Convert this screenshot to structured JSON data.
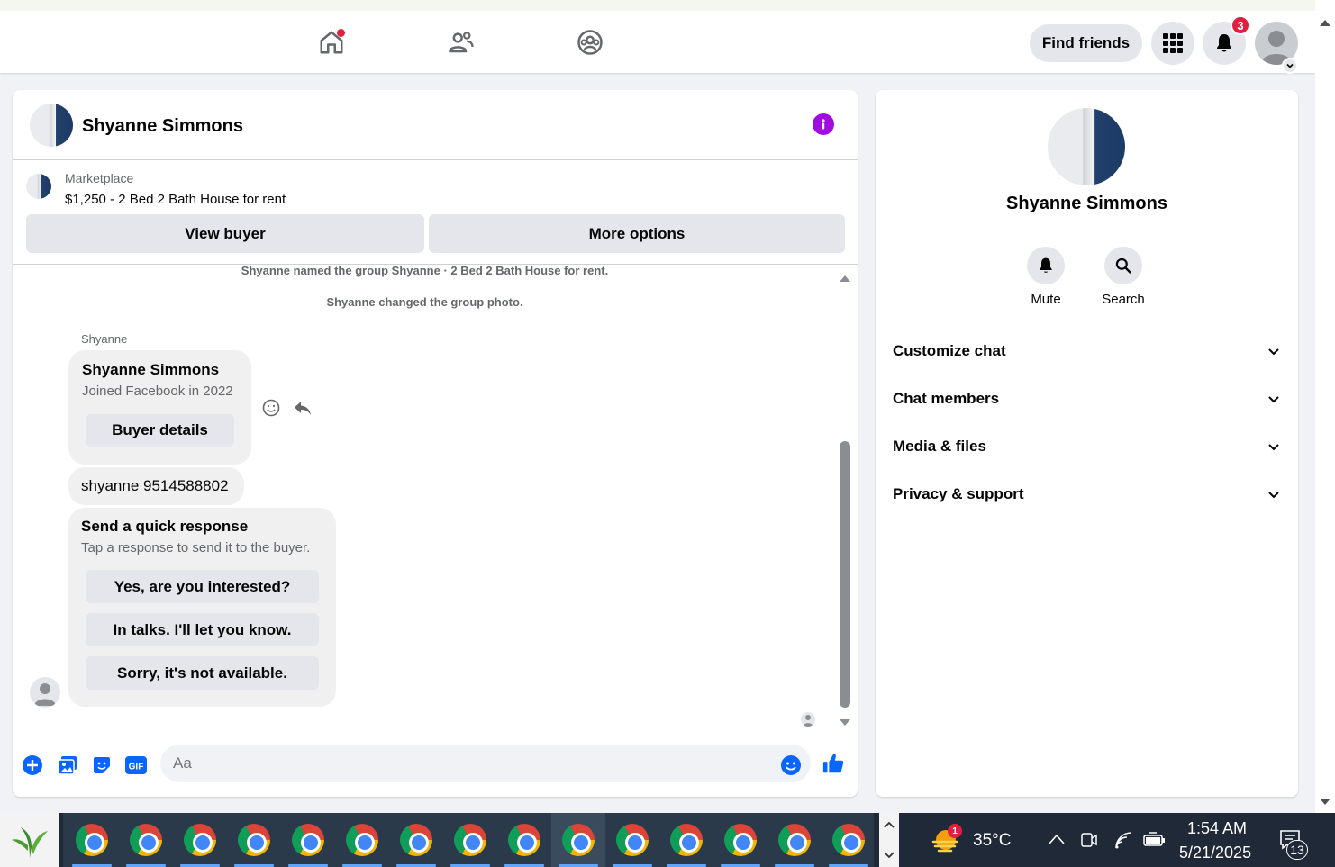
{
  "topbar": {
    "find_friends_label": "Find friends",
    "notification_count": "3",
    "nav_icons": [
      "home-icon",
      "friends-icon",
      "groups-icon"
    ]
  },
  "chat": {
    "header_name": "Shyanne Simmons",
    "listing": {
      "label": "Marketplace",
      "title": "$1,250 - 2 Bed 2 Bath House for rent",
      "view_buyer": "View buyer",
      "more_options": "More options"
    },
    "system_messages": [
      "Shyanne named the group Shyanne · 2 Bed 2 Bath House for rent.",
      "Shyanne changed the group photo."
    ],
    "sender_label": "Shyanne",
    "profile_card": {
      "name": "Shyanne Simmons",
      "subtitle": "Joined Facebook in 2022",
      "button": "Buyer details"
    },
    "text_message": "shyanne 9514588802",
    "quick_response": {
      "title": "Send a quick response",
      "subtitle": "Tap a response to send it to the buyer.",
      "options": [
        "Yes, are you interested?",
        "In talks. I'll let you know.",
        "Sorry, it's not available."
      ]
    },
    "composer": {
      "placeholder": "Aa"
    }
  },
  "details": {
    "name": "Shyanne Simmons",
    "actions": [
      {
        "label": "Mute",
        "icon": "bell-icon"
      },
      {
        "label": "Search",
        "icon": "search-icon"
      }
    ],
    "sections": [
      "Customize chat",
      "Chat members",
      "Media & files",
      "Privacy & support"
    ]
  },
  "taskbar": {
    "weather_badge": "1",
    "temperature": "35°C",
    "time": "1:54 AM",
    "date": "5/21/2025",
    "notification_count": "13",
    "colors": {
      "accent": "#0866ff",
      "badge": "#e41e3f",
      "info": "#a10de0"
    }
  }
}
